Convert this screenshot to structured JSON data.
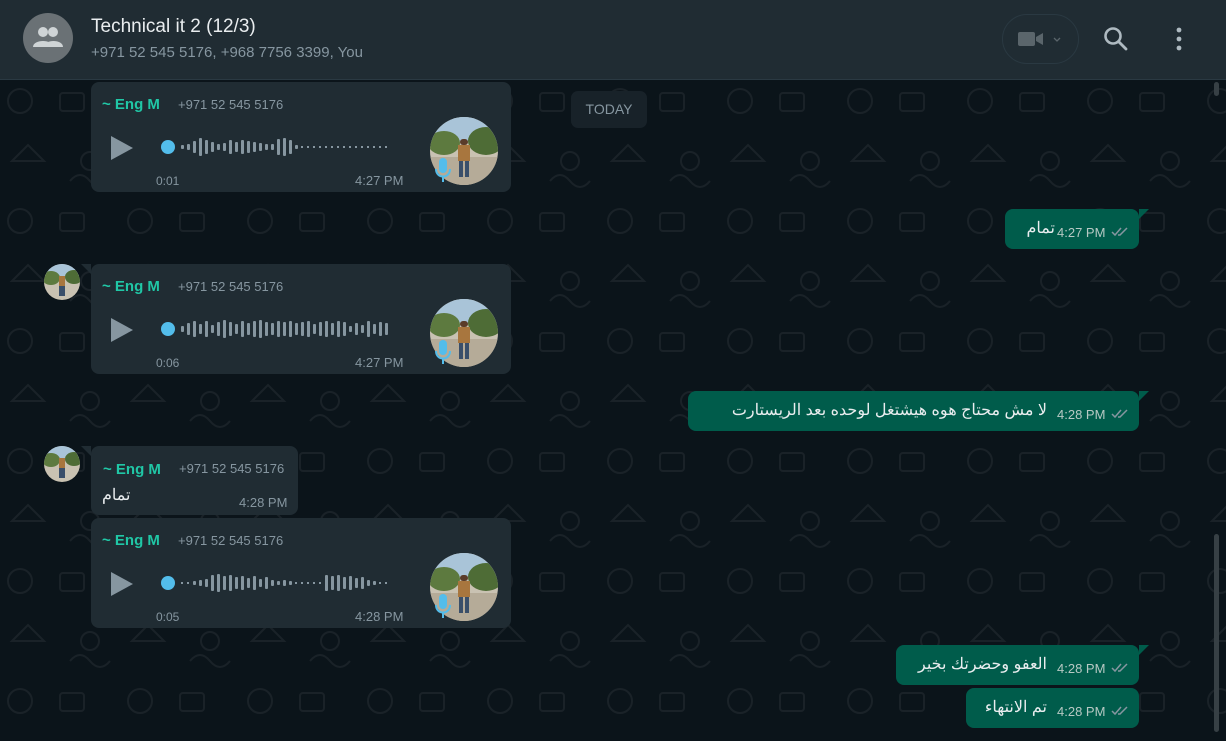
{
  "header": {
    "title": "Technical it 2 (12/3)",
    "subtitle": "+971 52 545 5176, +968 7756 3399, You"
  },
  "date_chip": "TODAY",
  "messages": [
    {
      "type": "voice-in",
      "sender": "~ Eng M",
      "phone": "+971 52 545 5176",
      "duration": "0:01",
      "time": "4:27 PM"
    },
    {
      "type": "text-out",
      "text": "تمام",
      "time": "4:27 PM",
      "status": "read"
    },
    {
      "type": "voice-in",
      "sender": "~ Eng M",
      "phone": "+971 52 545 5176",
      "duration": "0:06",
      "time": "4:27 PM"
    },
    {
      "type": "text-out",
      "text": "لا مش محتاج هوه هيشتغل لوحده بعد الريستارت",
      "time": "4:28 PM",
      "status": "read"
    },
    {
      "type": "text-in",
      "sender": "~ Eng M",
      "phone": "+971 52 545 5176",
      "text": "تمام",
      "time": "4:28 PM"
    },
    {
      "type": "voice-in",
      "sender": "~ Eng M",
      "phone": "+971 52 545 5176",
      "duration": "0:05",
      "time": "4:28 PM"
    },
    {
      "type": "text-out",
      "text": "العفو وحضرتك بخير",
      "time": "4:28 PM",
      "status": "read"
    },
    {
      "type": "text-out",
      "text": "تم الانتهاء",
      "time": "4:28 PM",
      "status": "read"
    }
  ],
  "colors": {
    "header_bg": "#202c33",
    "chat_bg": "#0b141a",
    "incoming_bubble": "#202c33",
    "outgoing_bubble": "#005c4b",
    "sender_name": "#20c7a6",
    "voice_dot": "#53bdeb"
  },
  "icons": [
    "group-avatar-icon",
    "video-call-icon",
    "chevron-down-icon",
    "search-icon",
    "menu-icon",
    "play-icon",
    "mic-icon",
    "read-ticks-icon"
  ]
}
